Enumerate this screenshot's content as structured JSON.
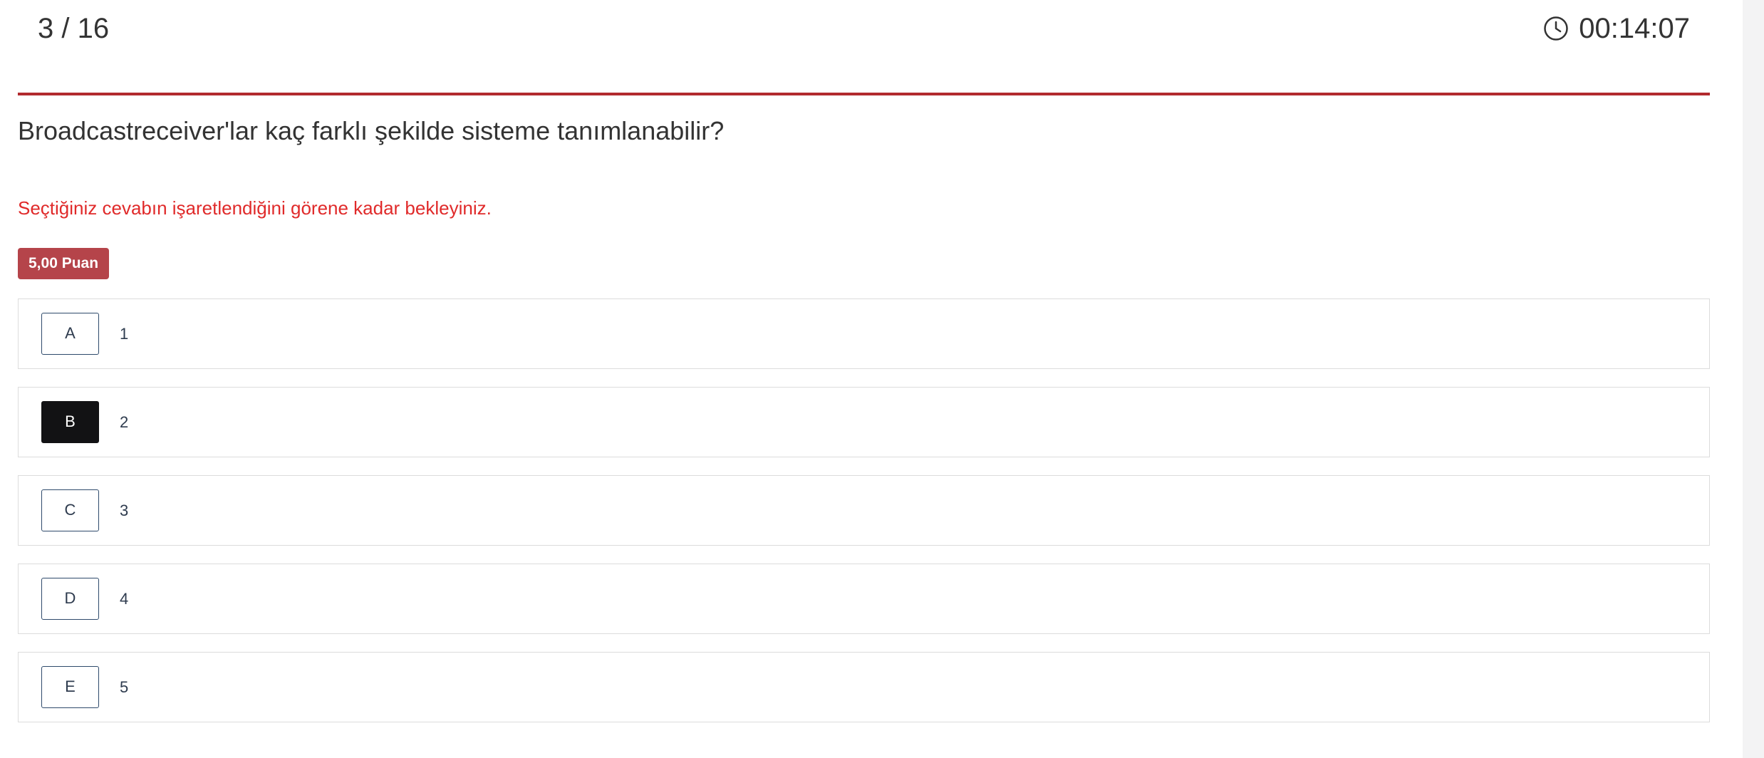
{
  "header": {
    "counter": "3 / 16",
    "timer": "00:14:07",
    "timer_icon": "clock-icon"
  },
  "question": {
    "text": "Broadcastreceiver'lar kaç farklı şekilde sisteme tanımlanabilir?",
    "notice": "Seçtiğiniz cevabın işaretlendiğini görene kadar bekleyiniz.",
    "points": "5,00 Puan"
  },
  "options": [
    {
      "letter": "A",
      "text": "1",
      "selected": false
    },
    {
      "letter": "B",
      "text": "2",
      "selected": true
    },
    {
      "letter": "C",
      "text": "3",
      "selected": false
    },
    {
      "letter": "D",
      "text": "4",
      "selected": false
    },
    {
      "letter": "E",
      "text": "5",
      "selected": false
    }
  ],
  "colors": {
    "accent": "#b22a2e",
    "notice": "#e02a2a",
    "badge": "#b5444a",
    "selected_letter_bg": "#121214"
  }
}
